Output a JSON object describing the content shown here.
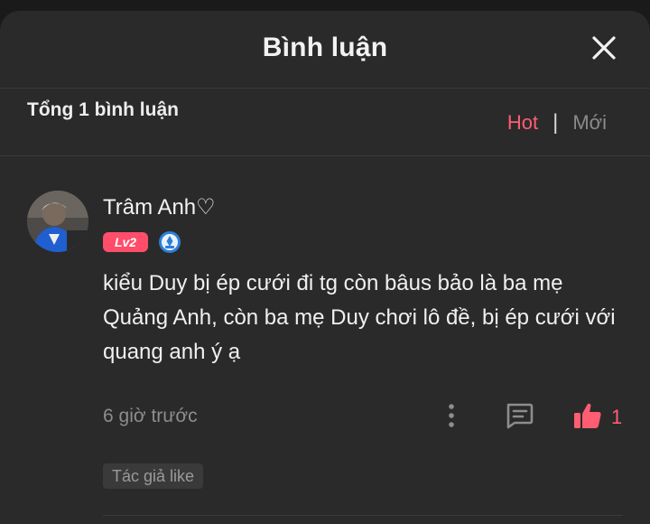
{
  "header": {
    "title": "Bình luận",
    "close_icon": "close-icon"
  },
  "toolbar": {
    "count_label": "Tổng 1 bình luận",
    "sort_hot": "Hot",
    "separator": "|",
    "sort_new": "Mới"
  },
  "comment": {
    "username": "Trâm Anh♡",
    "level": "Lv2",
    "badge_icon": "medal-icon",
    "text": "kiểu Duy bị ép cưới đi tg còn bâus bảo là ba mẹ Quảng Anh, còn ba mẹ Duy chơi lô đề, bị ép cưới với quang anh ý ạ",
    "time": "6 giờ trước",
    "like_count": "1",
    "author_like": "Tác giả like"
  },
  "colors": {
    "accent": "#ff5d72",
    "background": "#2a2a2a",
    "badge": "#ff4d6a"
  }
}
